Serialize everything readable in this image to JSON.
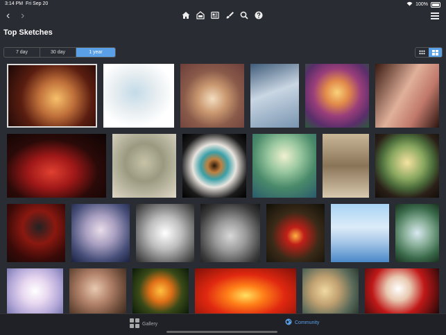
{
  "status": {
    "time": "3:14 PM",
    "date": "Fri Sep 20",
    "battery": "100%"
  },
  "toolbar": {
    "back": "‹",
    "forward": "›"
  },
  "title": "Top Sketches",
  "segments": [
    "7 day",
    "30 day",
    "1 year"
  ],
  "selected_segment": "1 year",
  "tabs": {
    "gallery": "Gallery",
    "community": "Community"
  },
  "colors": {
    "accent": "#5aa0e6",
    "background": "#2a2c33"
  }
}
